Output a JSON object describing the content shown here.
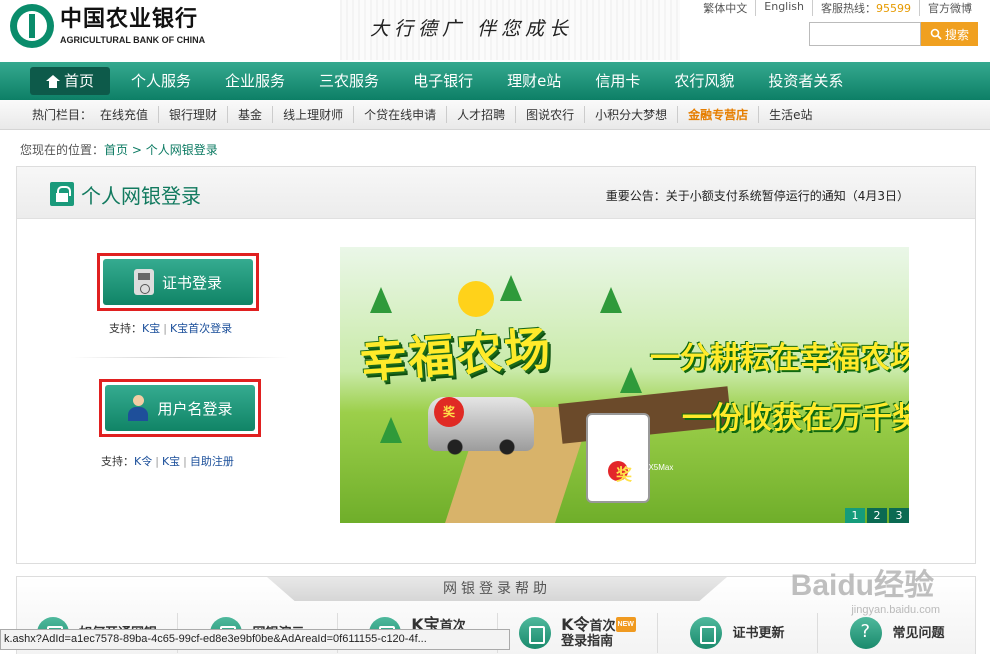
{
  "header": {
    "logo_cn": "中国农业银行",
    "logo_en": "AGRICULTURAL BANK OF CHINA",
    "slogan": "大行德广   伴您成长",
    "toplinks": [
      "繁体中文",
      "English",
      "客服热线：",
      "95599",
      "官方微博"
    ],
    "search_button": "搜索",
    "search_placeholder": ""
  },
  "nav": {
    "items": [
      "首页",
      "个人服务",
      "企业服务",
      "三农服务",
      "电子银行",
      "理财e站",
      "信用卡",
      "农行风貌",
      "投资者关系"
    ]
  },
  "subnav": {
    "label": "热门栏目：",
    "items": [
      "在线充值",
      "银行理财",
      "基金",
      "线上理财师",
      "个贷在线申请",
      "人才招聘",
      "图说农行",
      "小积分大梦想",
      "金融专营店",
      "生活e站"
    ]
  },
  "breadcrumb": {
    "prefix": "您现在的位置：",
    "home": "首页",
    "sep": " > ",
    "current": "个人网银登录"
  },
  "panel": {
    "title": "个人网银登录",
    "notice": "重要公告：关于小额支付系统暂停运行的通知（4月3日）",
    "cert_login": "证书登录",
    "cert_support_label": "支持：",
    "cert_support_1": "K宝",
    "cert_support_2": "K宝首次登录",
    "user_login": "用户名登录",
    "user_support_label": "支持：",
    "user_support_1": "K令",
    "user_support_2": "K宝",
    "user_support_3": "自助注册"
  },
  "banner": {
    "title": "幸福农场",
    "line1": "一分耕耘在幸福农场",
    "line2": "一份收获在万千奖品",
    "badge": "奖",
    "badge2": "奖",
    "brand": "vivo X5Max",
    "pages": [
      "1",
      "2",
      "3"
    ],
    "current_page": "1"
  },
  "help": {
    "title": "网银登录帮助",
    "items": [
      {
        "a": "如何开通网银",
        "b": ""
      },
      {
        "a": "网银演示",
        "b": ""
      },
      {
        "a": "K宝",
        "b": "首次"
      },
      {
        "a": "K令",
        "b": "首次"
      },
      {
        "a": "证书更新",
        "b": ""
      },
      {
        "a": "常见问题",
        "b": ""
      }
    ],
    "k_guide": "登录指南",
    "new_badge": "NEW"
  },
  "statusbar": {
    "url": "k.ashx?AdId=a1ec7578-89ba-4c65-99cf-ed8e3e9bf0be&AdAreaId=0f611155-c120-4f..."
  },
  "watermark": {
    "text": "Baidu经验",
    "sub": "jingyan.baidu.com"
  }
}
